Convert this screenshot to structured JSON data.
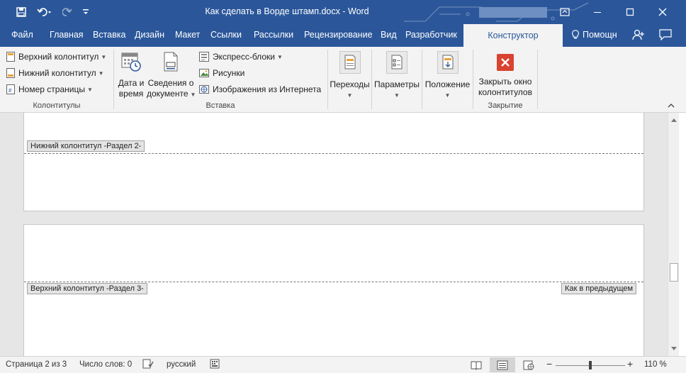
{
  "window": {
    "title": "Как сделать в Ворде штамп.docx - Word"
  },
  "tabs": [
    {
      "label": "Файл"
    },
    {
      "label": "Главная"
    },
    {
      "label": "Вставка"
    },
    {
      "label": "Дизайн"
    },
    {
      "label": "Макет"
    },
    {
      "label": "Ссылки"
    },
    {
      "label": "Рассылки"
    },
    {
      "label": "Рецензирование"
    },
    {
      "label": "Вид"
    },
    {
      "label": "Разработчик"
    },
    {
      "label": "Конструктор"
    }
  ],
  "active_tab": "Конструктор",
  "help_label": "Помощн",
  "ribbon": {
    "group_headers_footers": {
      "label": "Колонтитулы",
      "items": [
        {
          "label": "Верхний колонтитул"
        },
        {
          "label": "Нижний колонтитул"
        },
        {
          "label": "Номер страницы"
        }
      ]
    },
    "group_insert": {
      "label": "Вставка",
      "date_time": {
        "line1": "Дата и",
        "line2": "время"
      },
      "doc_info": {
        "line1": "Сведения о",
        "line2": "документе"
      },
      "items": [
        {
          "label": "Экспресс-блоки"
        },
        {
          "label": "Рисунки"
        },
        {
          "label": "Изображения из Интернета"
        }
      ]
    },
    "navigation": {
      "label": "Переходы"
    },
    "options": {
      "label": "Параметры"
    },
    "position": {
      "label": "Положение"
    },
    "group_close": {
      "label": "Закрытие",
      "close_button": {
        "line1": "Закрыть окно",
        "line2": "колонтитулов"
      }
    }
  },
  "document": {
    "footer_tag_section2": "Нижний колонтитул -Раздел 2-",
    "header_tag_section3": "Верхний колонтитул -Раздел 3-",
    "same_as_previous": "Как в предыдущем"
  },
  "statusbar": {
    "page": "Страница 2 из 3",
    "words": "Число слов: 0",
    "language": "русский",
    "zoom": "110 %"
  },
  "colors": {
    "accent": "#2b579a",
    "ribbon_bg": "#f3f3f3",
    "close_red": "#d9432f"
  }
}
